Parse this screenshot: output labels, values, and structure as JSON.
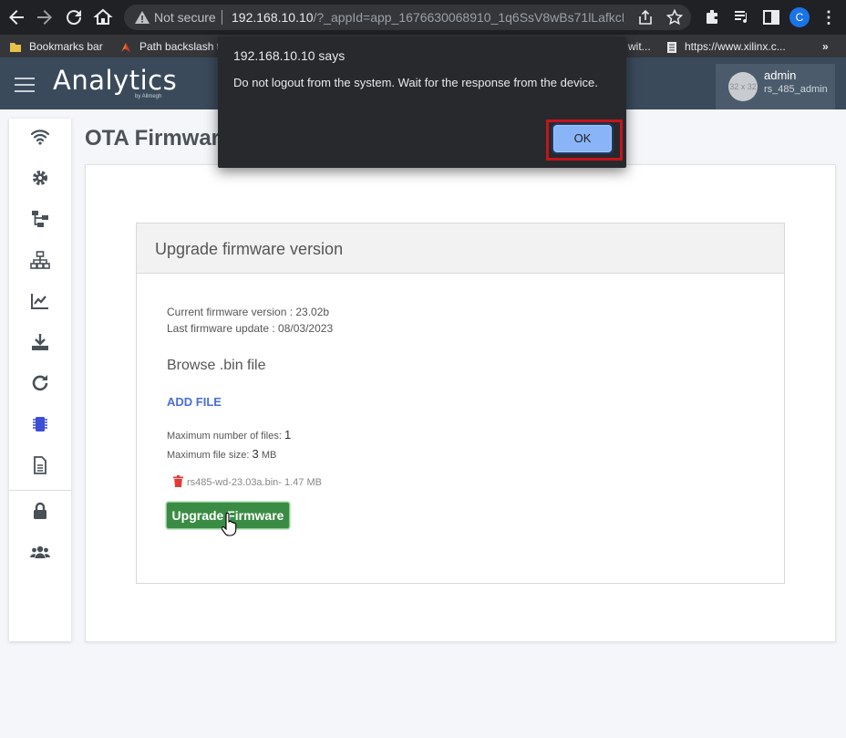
{
  "browser": {
    "not_secure": "Not secure",
    "url_host": "192.168.10.10",
    "url_path": "/?_appId=app_1676630068910_1q6SsV8wBs71lLafkcD...",
    "profile_initial": "C"
  },
  "bookmarks": [
    {
      "label": "Bookmarks bar",
      "icon": "folder-icon"
    },
    {
      "label": "Path backslash t",
      "icon": "bookmark-favicon"
    },
    {
      "label": "wit...",
      "icon": "bookmark-favicon"
    },
    {
      "label": "https://www.xilinx.c...",
      "icon": "page-icon"
    }
  ],
  "header": {
    "logo_text": "Analytics",
    "logo_sub": "by Allmegh",
    "avatar_text": "32 x 32",
    "username": "admin",
    "role": "rs_485_admin"
  },
  "sidebar": {
    "items": [
      {
        "icon": "wifi-icon",
        "active": false
      },
      {
        "icon": "gear-icon",
        "active": false
      },
      {
        "icon": "network-tree-icon",
        "active": false
      },
      {
        "icon": "sitemap-icon",
        "active": false
      },
      {
        "icon": "chart-line-icon",
        "active": false
      },
      {
        "icon": "download-icon",
        "active": false
      },
      {
        "icon": "refresh-icon",
        "active": false
      },
      {
        "icon": "chip-icon",
        "active": true
      },
      {
        "icon": "document-icon",
        "active": false
      },
      {
        "icon": "lock-icon",
        "active": false
      },
      {
        "icon": "users-icon",
        "active": false
      }
    ]
  },
  "page": {
    "title": "OTA Firmware"
  },
  "card": {
    "title": "Upgrade firmware version",
    "current_version": "Current firmware version : 23.02b",
    "last_update": "Last firmware update : 08/03/2023",
    "browse_label": "Browse .bin file",
    "add_file": "ADD FILE",
    "max_files_label": "Maximum number of files:",
    "max_files_value": "1",
    "max_size_label": "Maximum file size:",
    "max_size_value": "3",
    "max_size_unit": "MB",
    "file_name": "rs485-wd-23.03a.bin- 1.47 MB",
    "upgrade_button": "Upgrade Firmware"
  },
  "dialog": {
    "title": "192.168.10.10 says",
    "message": "Do not logout from the system. Wait for the response from the device.",
    "ok_label": "OK"
  },
  "colors": {
    "header_bg": "#3a4a5b",
    "upgrade_green": "#3a8c44",
    "link_blue": "#4a6fd6",
    "highlight_red": "#c4141b",
    "active_icon": "#3d4fd6"
  }
}
